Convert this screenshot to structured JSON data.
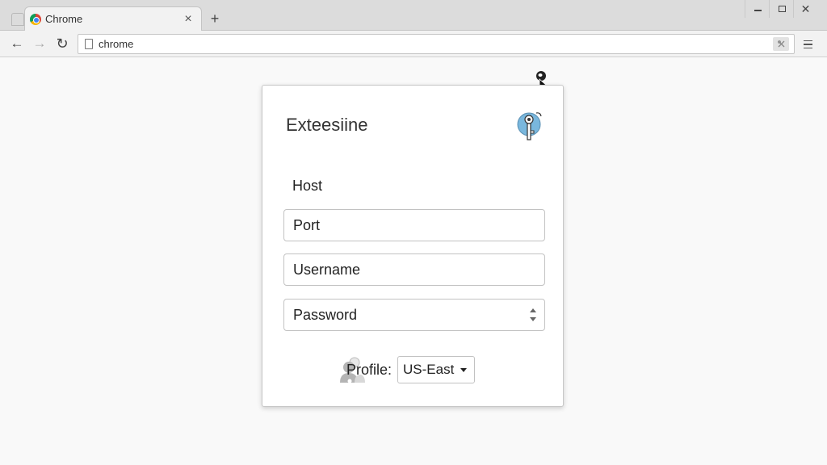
{
  "browser": {
    "tab_title": "Chrome",
    "tab_close_glyph": "×",
    "new_tab_glyph": "+",
    "close_window_glyph": "✕",
    "back_glyph": "←",
    "forward_glyph": "→",
    "reload_glyph": "↻",
    "address": "chrome"
  },
  "dialog": {
    "title": "Exteesiine",
    "host_label": "Host",
    "port_field": "Port",
    "username_field": "Username",
    "password_field": "Password",
    "profile_label": "Profile:",
    "profile_value": "US-East"
  },
  "icons": {
    "tab_favicon": "chrome-logo-icon",
    "page": "page-icon",
    "bookmark": "bookmark-icon",
    "menu": "hamburger-menu-icon",
    "dialog_badge": "key-icon",
    "profile": "user-icon",
    "cursor": "mouse-pointer-icon"
  },
  "colors": {
    "accent_icon": "#79b7dd",
    "chrome_red": "#db4437",
    "chrome_yellow": "#f4b400",
    "chrome_green": "#0f9d58",
    "chrome_blue": "#4285f4"
  }
}
